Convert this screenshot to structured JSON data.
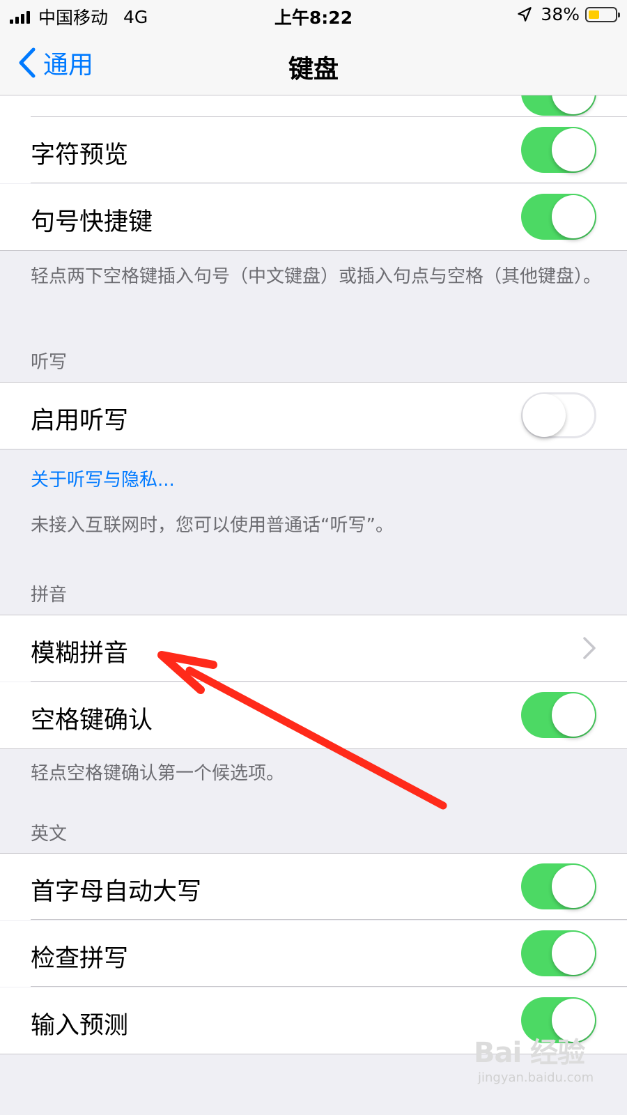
{
  "status_bar": {
    "carrier": "中国移动",
    "network": "4G",
    "time": "上午8:22",
    "battery_percent": "38%",
    "battery_color": "#ffcc00"
  },
  "nav": {
    "back_label": "通用",
    "title": "键盘"
  },
  "rows_top": [
    {
      "label": "字符预览",
      "toggle": "on"
    },
    {
      "label": "句号快捷键",
      "toggle": "on"
    }
  ],
  "period_footer": "轻点两下空格键插入句号（中文键盘）或插入句点与空格（其他键盘）。",
  "dictation": {
    "header": "听写",
    "enable_label": "启用听写",
    "enable_toggle": "off",
    "privacy_link": "关于听写与隐私...",
    "footer": "未接入互联网时，您可以使用普通话“听写”。"
  },
  "pinyin": {
    "header": "拼音",
    "fuzzy_label": "模糊拼音",
    "space_confirm_label": "空格键确认",
    "space_confirm_toggle": "on",
    "footer": "轻点空格键确认第一个候选项。"
  },
  "english": {
    "header": "英文",
    "rows": [
      {
        "label": "首字母自动大写",
        "toggle": "on"
      },
      {
        "label": "检查拼写",
        "toggle": "on"
      },
      {
        "label": "输入预测",
        "toggle": "on"
      }
    ]
  },
  "colors": {
    "accent": "#007aff",
    "toggle_on": "#4cd964",
    "annotation_arrow": "#ff2a1a"
  },
  "watermark": {
    "logo": "Bai 经验",
    "sub": "jingyan.baidu.com"
  }
}
